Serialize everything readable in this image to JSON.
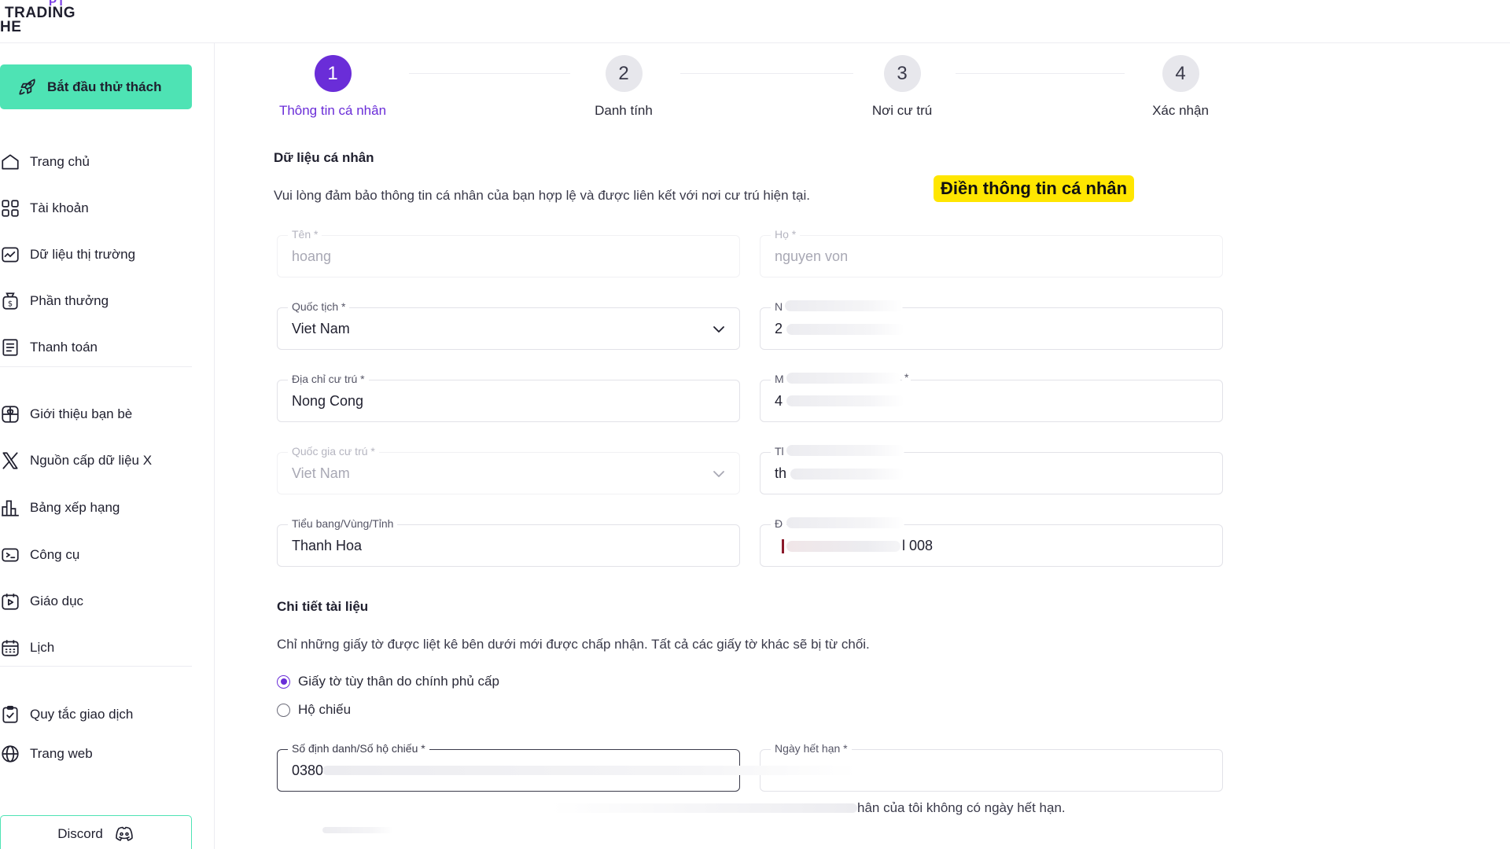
{
  "logo": {
    "line1": "PT",
    "line2": "TRADING",
    "line3": "HE"
  },
  "sidebar": {
    "start_button": "Bắt đầu thử thách",
    "items": [
      {
        "label": "Trang chủ",
        "icon": "home-icon"
      },
      {
        "label": "Tài khoản",
        "icon": "grid-icon"
      },
      {
        "label": "Dữ liệu thị trường",
        "icon": "chart-line-icon"
      },
      {
        "label": "Phần thưởng",
        "icon": "money-bag-icon"
      },
      {
        "label": "Thanh toán",
        "icon": "receipt-icon"
      },
      {
        "label": "Giới thiệu bạn bè",
        "icon": "gift-icon"
      },
      {
        "label": "Nguồn cấp dữ liệu X",
        "icon": "x-logo-icon"
      },
      {
        "label": "Bảng xếp hạng",
        "icon": "leaderboard-icon"
      },
      {
        "label": "Công cụ",
        "icon": "tools-icon"
      },
      {
        "label": "Giáo dục",
        "icon": "education-icon"
      },
      {
        "label": "Lịch",
        "icon": "calendar-icon"
      },
      {
        "label": "Quy tắc giao dịch",
        "icon": "clipboard-check-icon"
      },
      {
        "label": "Trang web",
        "icon": "globe-icon"
      }
    ],
    "discord_button": "Discord"
  },
  "stepper": [
    {
      "number": "1",
      "label": "Thông tin cá nhân"
    },
    {
      "number": "2",
      "label": "Danh tính"
    },
    {
      "number": "3",
      "label": "Nơi cư trú"
    },
    {
      "number": "4",
      "label": "Xác nhận"
    }
  ],
  "personal": {
    "title": "Dữ liệu cá nhân",
    "description": "Vui lòng đảm bảo thông tin cá nhân của bạn hợp lệ và được liên kết với nơi cư trú hiện tại.",
    "highlight": "Điền thông tin cá nhân",
    "first_name": {
      "label": "Tên *",
      "value": "hoang"
    },
    "last_name": {
      "label": "Họ *",
      "value": "nguyen von"
    },
    "nationality": {
      "label": "Quốc tịch *",
      "value": "Viet Nam"
    },
    "right_field_1": {
      "label": "N",
      "value": "2"
    },
    "address": {
      "label": "Địa chỉ cư trú *",
      "value": "Nong Cong"
    },
    "right_field_2": {
      "label": "M",
      "asterisk": "*",
      "value": "4"
    },
    "country": {
      "label": "Quốc gia cư trú *",
      "value": "Viet Nam"
    },
    "right_field_3": {
      "label": "Tl",
      "value": "th"
    },
    "state": {
      "label": "Tiểu bang/Vùng/Tỉnh",
      "value": "Thanh Hoa"
    },
    "right_field_4": {
      "label": "Đ",
      "value": "l 008"
    }
  },
  "documents": {
    "title": "Chi tiết tài liệu",
    "description": "Chỉ những giấy tờ được liệt kê bên dưới mới được chấp nhận. Tất cả các giấy tờ khác sẽ bị từ chối.",
    "option_id": "Giấy tờ tùy thân do chính phủ cấp",
    "option_passport": "Hộ chiếu",
    "id_number": {
      "label": "Số định danh/Số hộ chiếu *",
      "value": "0380"
    },
    "expiry": {
      "label": "Ngày hết hạn *",
      "value": ""
    },
    "no_expiry_text": "hân của tôi không có ngày hết hạn."
  },
  "colors": {
    "accent": "#6a2dd8",
    "brand_green": "#4ee3b4",
    "highlight": "#ffe600"
  }
}
